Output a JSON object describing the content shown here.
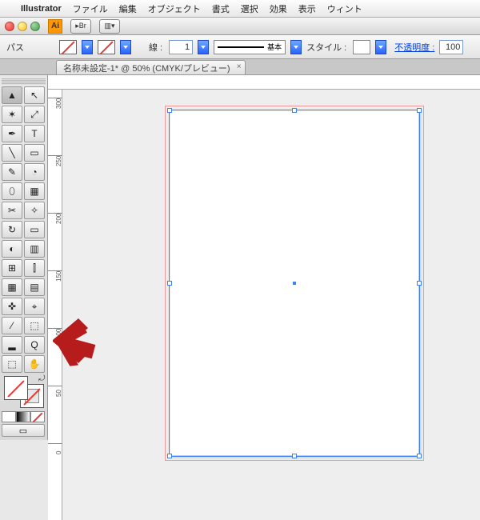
{
  "menu": {
    "app": "Illustrator",
    "items": [
      "ファイル",
      "編集",
      "オブジェクト",
      "書式",
      "選択",
      "効果",
      "表示",
      "ウィント"
    ]
  },
  "titlebar": {
    "app_icon": "Ai",
    "br_btn": "▸Br",
    "layout_btn": "▥▾"
  },
  "options": {
    "path_label": "パス",
    "stroke_label": "線 :",
    "stroke_weight": "1",
    "stroke_preset": "基本",
    "style_label": "スタイル :",
    "opacity_label": "不透明度 :",
    "opacity_value": "100"
  },
  "tab": {
    "title": "名称未設定-1* @ 50%  (CMYK/プレビュー)",
    "close": "×"
  },
  "ruler": {
    "vticks": [
      "300",
      "250",
      "200",
      "150",
      "100",
      "50",
      "0"
    ]
  },
  "tool_icons": [
    [
      "▲",
      "↖"
    ],
    [
      "✶",
      "⤢"
    ],
    [
      "✒",
      "T"
    ],
    [
      "╲",
      "▭"
    ],
    [
      "✎",
      "◔"
    ],
    [
      "⬯",
      "▦"
    ],
    [
      "✂",
      "✧"
    ],
    [
      "↻",
      "▭"
    ],
    [
      "◐",
      "▥"
    ],
    [
      "⊞",
      "⫿"
    ],
    [
      "▦",
      "▤"
    ],
    [
      "✜",
      "⌖"
    ],
    [
      "⁄",
      "⬚"
    ],
    [
      "▂",
      "Q"
    ],
    [
      "⬚",
      "✋"
    ]
  ]
}
